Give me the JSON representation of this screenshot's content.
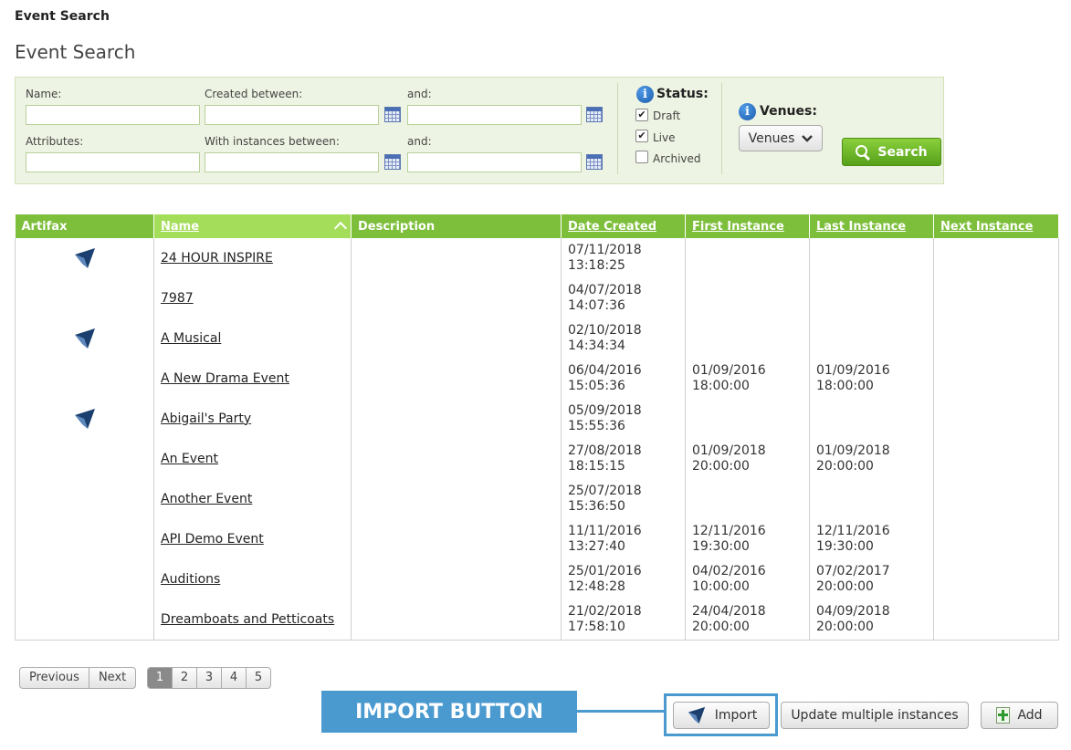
{
  "breadcrumb": "Event Search",
  "page_title": "Event Search",
  "search": {
    "name_label": "Name:",
    "created_between_label": "Created between:",
    "and_label_1": "and:",
    "attributes_label": "Attributes:",
    "instances_between_label": "With instances between:",
    "and_label_2": "and:",
    "status_title": "Status:",
    "status_options": [
      {
        "label": "Draft",
        "checked": true
      },
      {
        "label": "Live",
        "checked": true
      },
      {
        "label": "Archived",
        "checked": false
      }
    ],
    "venues_title": "Venues:",
    "venues_button": "Venues",
    "search_button": "Search",
    "info_glyph": "i"
  },
  "table": {
    "headers": [
      "Artifax",
      "Name",
      "Description",
      "Date Created",
      "First Instance",
      "Last Instance",
      "Next Instance"
    ],
    "rows": [
      {
        "artifax": true,
        "name": "24 HOUR INSPIRE",
        "description": "",
        "created": [
          "07/11/2018",
          "13:18:25"
        ],
        "first": [
          "",
          ""
        ],
        "last": [
          "",
          ""
        ],
        "next": [
          "",
          ""
        ]
      },
      {
        "artifax": false,
        "name": "7987",
        "description": "",
        "created": [
          "04/07/2018",
          "14:07:36"
        ],
        "first": [
          "",
          ""
        ],
        "last": [
          "",
          ""
        ],
        "next": [
          "",
          ""
        ]
      },
      {
        "artifax": true,
        "name": "A Musical",
        "description": "",
        "created": [
          "02/10/2018",
          "14:34:34"
        ],
        "first": [
          "",
          ""
        ],
        "last": [
          "",
          ""
        ],
        "next": [
          "",
          ""
        ]
      },
      {
        "artifax": false,
        "name": "A New Drama Event",
        "description": "",
        "created": [
          "06/04/2016",
          "15:05:36"
        ],
        "first": [
          "01/09/2016",
          "18:00:00"
        ],
        "last": [
          "01/09/2016",
          "18:00:00"
        ],
        "next": [
          "",
          ""
        ]
      },
      {
        "artifax": true,
        "name": "Abigail's Party",
        "description": "",
        "created": [
          "05/09/2018",
          "15:55:36"
        ],
        "first": [
          "",
          ""
        ],
        "last": [
          "",
          ""
        ],
        "next": [
          "",
          ""
        ]
      },
      {
        "artifax": false,
        "name": "An Event",
        "description": "",
        "created": [
          "27/08/2018",
          "18:15:15"
        ],
        "first": [
          "01/09/2018",
          "20:00:00"
        ],
        "last": [
          "01/09/2018",
          "20:00:00"
        ],
        "next": [
          "",
          ""
        ]
      },
      {
        "artifax": false,
        "name": "Another Event",
        "description": "",
        "created": [
          "25/07/2018",
          "15:36:50"
        ],
        "first": [
          "",
          ""
        ],
        "last": [
          "",
          ""
        ],
        "next": [
          "",
          ""
        ]
      },
      {
        "artifax": false,
        "name": "API Demo Event",
        "description": "",
        "created": [
          "11/11/2016",
          "13:27:40"
        ],
        "first": [
          "12/11/2016",
          "19:30:00"
        ],
        "last": [
          "12/11/2016",
          "19:30:00"
        ],
        "next": [
          "",
          ""
        ]
      },
      {
        "artifax": false,
        "name": "Auditions",
        "description": "",
        "created": [
          "25/01/2016",
          "12:48:28"
        ],
        "first": [
          "04/02/2016",
          "10:00:00"
        ],
        "last": [
          "07/02/2017",
          "20:00:00"
        ],
        "next": [
          "",
          ""
        ]
      },
      {
        "artifax": false,
        "name": "Dreamboats and Petticoats",
        "description": "",
        "created": [
          "21/02/2018",
          "17:58:10"
        ],
        "first": [
          "24/04/2018",
          "20:00:00"
        ],
        "last": [
          "04/09/2018",
          "20:00:00"
        ],
        "next": [
          "",
          ""
        ]
      }
    ]
  },
  "pagination": {
    "previous": "Previous",
    "next": "Next",
    "pages": [
      "1",
      "2",
      "3",
      "4",
      "5"
    ],
    "current": "1"
  },
  "annotation": {
    "label": "IMPORT BUTTON"
  },
  "actions": {
    "import": "Import",
    "update_multiple": "Update multiple instances",
    "add": "Add"
  },
  "colors": {
    "header_green": "#7dbe3b",
    "sorted_header": "#a4dd5a",
    "search_green": "#56a01a",
    "panel_bg": "#eef4e3",
    "callout_blue": "#4a9ad0"
  }
}
